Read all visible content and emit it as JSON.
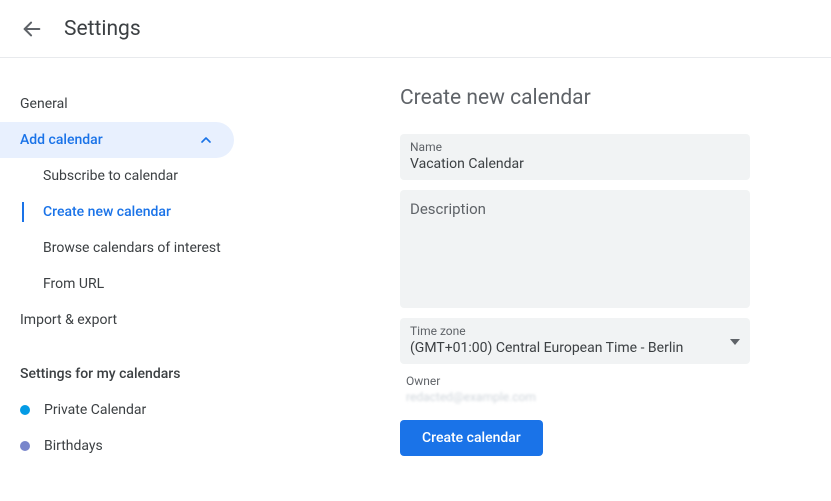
{
  "header": {
    "title": "Settings"
  },
  "sidebar": {
    "general": "General",
    "add_calendar": {
      "label": "Add calendar",
      "items": [
        "Subscribe to calendar",
        "Create new calendar",
        "Browse calendars of interest",
        "From URL"
      ]
    },
    "import_export": "Import & export",
    "my_calendars_heading": "Settings for my calendars",
    "my_calendars": [
      {
        "label": "Private Calendar",
        "color": "#039be5"
      },
      {
        "label": "Birthdays",
        "color": "#7986cb"
      }
    ]
  },
  "main": {
    "title": "Create new calendar",
    "name_label": "Name",
    "name_value": "Vacation Calendar",
    "description_label": "Description",
    "description_value": "",
    "timezone_label": "Time zone",
    "timezone_value": "(GMT+01:00) Central European Time - Berlin",
    "owner_label": "Owner",
    "owner_value": "redacted@example.com",
    "create_button": "Create calendar"
  }
}
